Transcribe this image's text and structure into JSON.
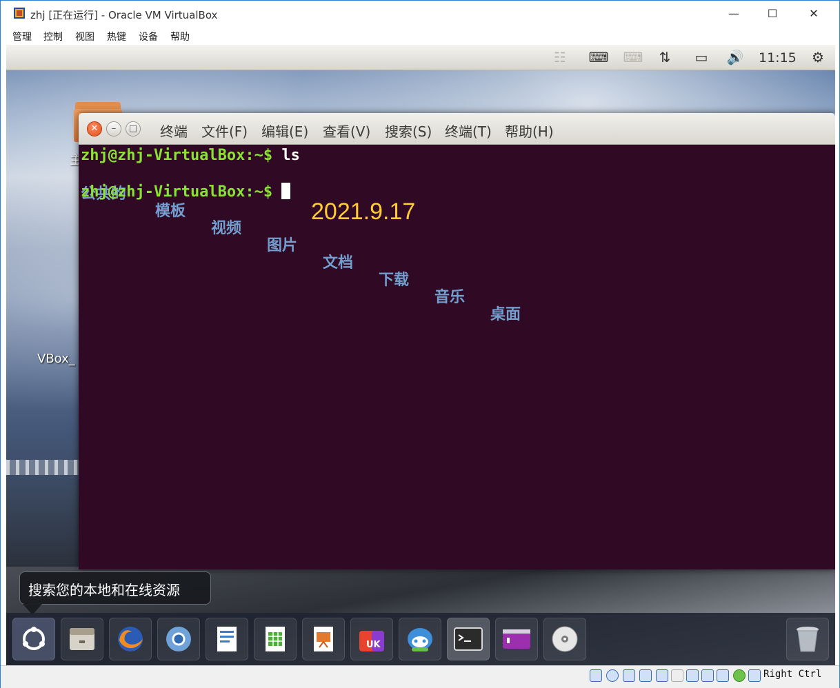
{
  "host": {
    "title": "zhj [正在运行] - Oracle VM VirtualBox",
    "menu": [
      "管理",
      "控制",
      "视图",
      "热键",
      "设备",
      "帮助"
    ],
    "status_hostkey": "Right Ctrl"
  },
  "panel": {
    "clock": "11:15"
  },
  "desktop": {
    "labels": [
      "主",
      "VBox_"
    ]
  },
  "terminal": {
    "menu": [
      "终端",
      "文件(F)",
      "编辑(E)",
      "查看(V)",
      "搜索(S)",
      "终端(T)",
      "帮助(H)"
    ],
    "prompt": "zhj@zhj-VirtualBox:~$",
    "command": "ls",
    "dirs": [
      "公共的",
      "模板",
      "视频",
      "图片",
      "文档",
      "下载",
      "音乐",
      "桌面"
    ],
    "note": "2021.9.17"
  },
  "tooltip": {
    "text": "搜索您的本地和在线资源"
  },
  "dock": {
    "items": [
      "dash-icon",
      "files-icon",
      "firefox-icon",
      "chromium-icon",
      "writer-icon",
      "calc-icon",
      "impress-icon",
      "ubuntu-kylin-icon",
      "assistant-icon",
      "terminal-icon",
      "screen-icon",
      "dvd-icon",
      "trash-icon"
    ]
  },
  "colors": {
    "terminal_bg": "#300a24",
    "prompt": "#8ae234",
    "directory": "#729fcf",
    "note": "#ffcc33"
  }
}
